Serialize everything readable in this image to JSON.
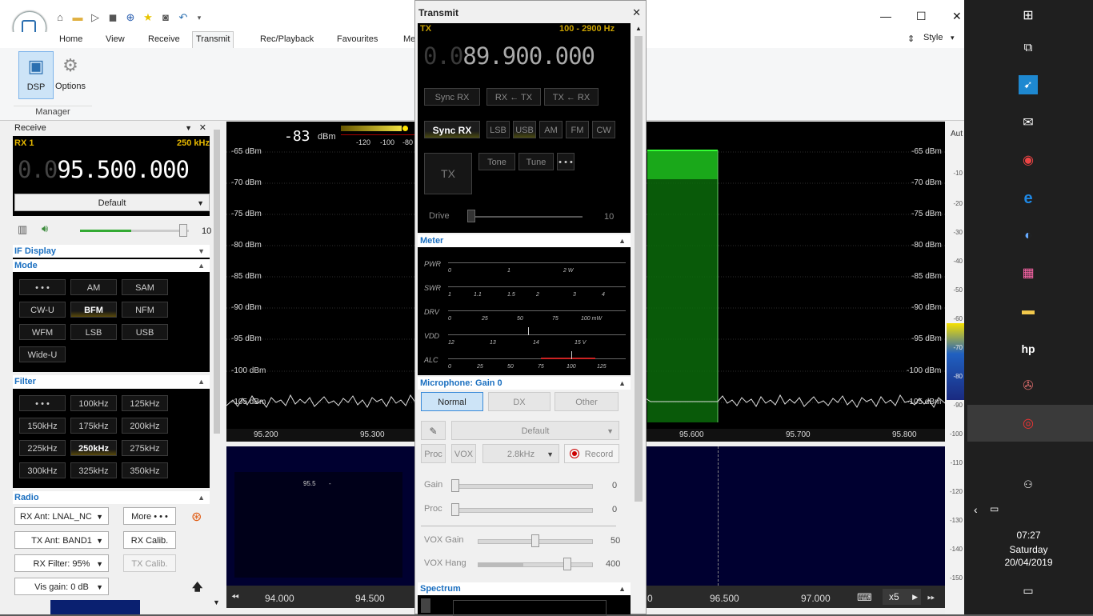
{
  "qat_icons": [
    "home-icon",
    "folder-icon",
    "play-icon",
    "stop-icon",
    "add-icon",
    "favourite-star-icon",
    "camera-icon",
    "undo-icon",
    "dropdown-icon"
  ],
  "ribbon": {
    "tabs": [
      "Home",
      "View",
      "Receive",
      "Transmit",
      "Rec/Playback",
      "Favourites",
      "Me"
    ],
    "active_tab": "Transmit",
    "style_label": "Style",
    "buttons": [
      {
        "label": "DSP",
        "icon": "dsp-icon"
      },
      {
        "label": "Options",
        "icon": "gear-icon"
      }
    ],
    "group_label": "Manager"
  },
  "receive": {
    "title": "Receive",
    "rx_label": "RX 1",
    "bandwidth": "250 kHz",
    "freq_dim": "0.0",
    "freq_main": "95.500.000",
    "preset": "Default",
    "volume_value": "10",
    "if_display_label": "IF Display",
    "mode_label": "Mode",
    "modes": [
      "• • •",
      "AM",
      "SAM",
      "CW-U",
      "BFM",
      "NFM",
      "WFM",
      "LSB",
      "USB",
      "Wide-U"
    ],
    "active_mode": "BFM",
    "filter_label": "Filter",
    "filters": [
      "• • •",
      "100kHz",
      "125kHz",
      "150kHz",
      "175kHz",
      "200kHz",
      "225kHz",
      "250kHz",
      "275kHz",
      "300kHz",
      "325kHz",
      "350kHz"
    ],
    "active_filter": "250kHz",
    "radio_label": "Radio",
    "rx_ant": "RX Ant: LNAL_NC",
    "tx_ant": "TX Ant: BAND1",
    "rx_filter": "RX Filter: 95%",
    "vis_gain": "Vis gain: 0 dB",
    "more_label": "More • • •",
    "rx_calib": "RX Calib.",
    "tx_calib": "TX Calib."
  },
  "spectrum": {
    "level_value": "-83",
    "level_unit": "dBm",
    "meter_ticks": [
      "-120",
      "-100",
      "-80"
    ],
    "db_labels_left": [
      "-65 dBm",
      "-70 dBm",
      "-75 dBm",
      "-80 dBm",
      "-85 dBm",
      "-90 dBm",
      "-95 dBm",
      "-100 dBm",
      "-105 dBm"
    ],
    "db_labels_right": [
      "-65 dBm",
      "-70 dBm",
      "-75 dBm",
      "-80 dBm",
      "-85 dBm",
      "-90 dBm",
      "-95 dBm",
      "-100 dBm",
      "-105 dBm"
    ],
    "freq_labels": [
      "95.200",
      "95.300",
      "95.600",
      "95.700",
      "95.800"
    ],
    "wf_marker": "95.5",
    "wf_freq_labels": [
      "94.000",
      "94.500",
      "0",
      "96.500",
      "97.000"
    ],
    "zoom": "x5",
    "right_scale": [
      "Aut",
      "-10",
      "-20",
      "-30",
      "-40",
      "-50",
      "-60",
      "-70",
      "-80",
      "-90",
      "-100",
      "-110",
      "-120",
      "-130",
      "-140",
      "-150"
    ]
  },
  "transmit": {
    "title": "Transmit",
    "tx_label": "TX",
    "range": "100 - 2900 Hz",
    "freq_dim": "0.0",
    "freq_main": "89.900.000",
    "sync_buttons": [
      "Sync RX",
      "RX ← TX",
      "TX ← RX"
    ],
    "mode_buttons": [
      "Sync RX",
      "LSB",
      "USB",
      "AM",
      "FM",
      "CW"
    ],
    "tx_button": "TX",
    "tone": "Tone",
    "tune": "Tune",
    "more": "• • •",
    "drive_label": "Drive",
    "drive_value": "10",
    "meter_label": "Meter",
    "meters": [
      {
        "name": "PWR",
        "ticks": [
          "0",
          "1",
          "2 W"
        ]
      },
      {
        "name": "SWR",
        "ticks": [
          "1",
          "1.1",
          "1.5",
          "2",
          "3",
          "4"
        ]
      },
      {
        "name": "DRV",
        "ticks": [
          "0",
          "25",
          "50",
          "75",
          "100 mW"
        ]
      },
      {
        "name": "VDD",
        "ticks": [
          "12",
          "13",
          "14",
          "15 V"
        ]
      },
      {
        "name": "ALC",
        "ticks": [
          "0",
          "25",
          "50",
          "75",
          "100",
          "125"
        ]
      }
    ],
    "mic_label": "Microphone: Gain 0",
    "mic_profiles": [
      "Normal",
      "DX",
      "Other"
    ],
    "mic_preset": "Default",
    "proc": "Proc",
    "vox": "VOX",
    "bw": "2.8kHz",
    "record": "Record",
    "sliders": [
      {
        "label": "Gain",
        "value": "0",
        "level": 0
      },
      {
        "label": "Proc",
        "value": "0",
        "level": 0
      },
      {
        "label": "VOX Gain",
        "value": "50",
        "level": 0.5
      },
      {
        "label": "VOX Hang",
        "value": "400",
        "level": 0.8
      }
    ],
    "spectrum_label": "Spectrum"
  },
  "taskbar": {
    "time": "07:27",
    "day": "Saturday",
    "date": "20/04/2019"
  }
}
